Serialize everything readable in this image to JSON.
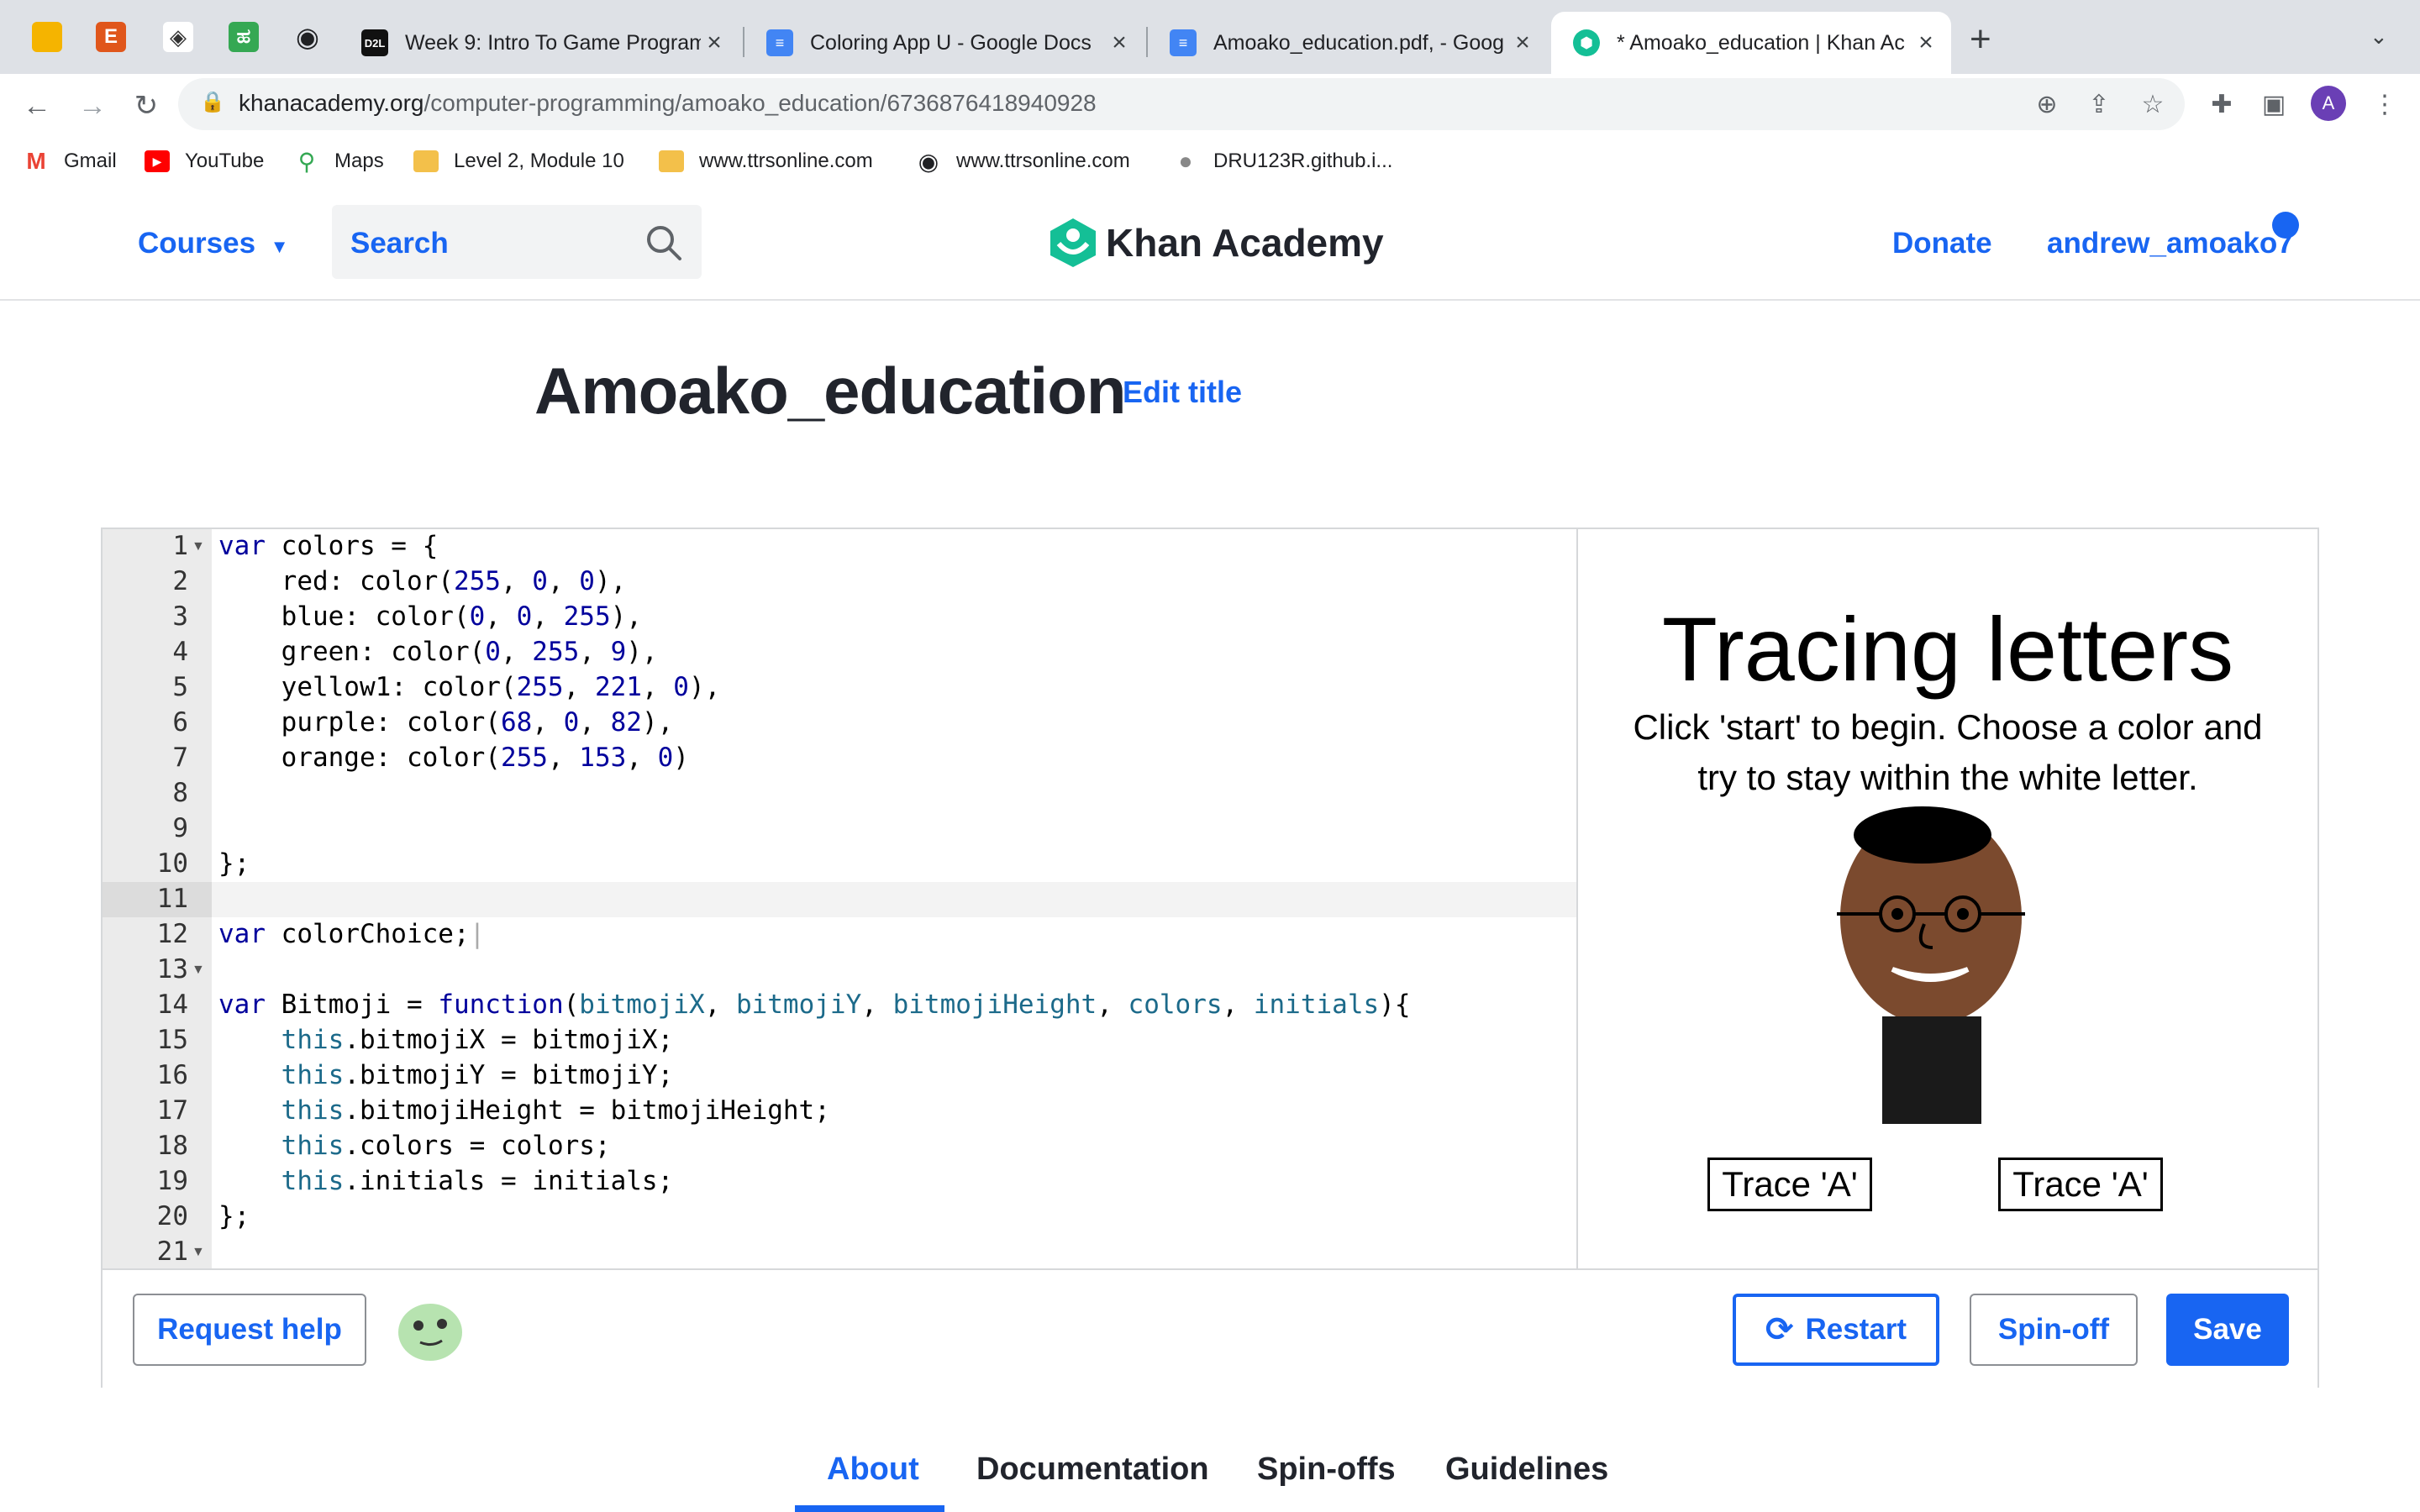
{
  "browser": {
    "pinned_tabs": [
      {
        "icon": "slides-icon",
        "color": "#f5b400"
      },
      {
        "icon": "etsy-e-icon",
        "label": "E",
        "color": "#e0561b"
      },
      {
        "icon": "diamond-icon",
        "color": "#333333"
      },
      {
        "icon": "green-app-icon",
        "color": "#35a853"
      },
      {
        "icon": "globe-icon",
        "color": "#202124"
      }
    ],
    "tabs": [
      {
        "title": "Week 9: Intro To Game Program",
        "favicon": "D2L"
      },
      {
        "title": "Coloring App U - Google Docs",
        "favicon": "docs"
      },
      {
        "title": "Amoako_education.pdf, - Goog",
        "favicon": "docs"
      },
      {
        "title": "* Amoako_education | Khan Ac",
        "favicon": "khan",
        "active": true
      }
    ],
    "new_tab": "+",
    "url_host": "khanacademy.org",
    "url_path": "/computer-programming/amoako_education/6736876418940928",
    "profile_initial": "A",
    "bookmarks": [
      {
        "label": "Gmail",
        "icon": "gmail-icon"
      },
      {
        "label": "YouTube",
        "icon": "youtube-icon"
      },
      {
        "label": "Maps",
        "icon": "maps-icon"
      },
      {
        "label": "Level 2, Module 10",
        "icon": "folder-icon"
      },
      {
        "label": "www.ttrsonline.com",
        "icon": "folder-icon"
      },
      {
        "label": "www.ttrsonline.com",
        "icon": "globe-icon"
      },
      {
        "label": "DRU123R.github.i...",
        "icon": "github-icon"
      }
    ]
  },
  "header": {
    "courses": "Courses",
    "search_placeholder": "Search",
    "logo_text": "Khan Academy",
    "donate": "Donate",
    "username": "andrew_amoako7"
  },
  "project": {
    "title": "Amoako_education",
    "edit_title": "Edit title"
  },
  "editor": {
    "line_numbers": [
      "1",
      "2",
      "3",
      "4",
      "5",
      "6",
      "7",
      "8",
      "9",
      "10",
      "11",
      "12",
      "13",
      "14",
      "15",
      "16",
      "17",
      "18",
      "19",
      "20",
      "21"
    ],
    "active_line": 11
  },
  "canvas": {
    "title": "Tracing letters",
    "instruction_line1": "Click 'start' to begin. Choose a color and",
    "instruction_line2": "try to stay within the white letter.",
    "buttons": [
      "Trace 'A'",
      "Trace 'A'"
    ]
  },
  "actions": {
    "request_help": "Request help",
    "restart": "Restart",
    "spinoff": "Spin-off",
    "save": "Save"
  },
  "bottom_tabs": [
    "About",
    "Documentation",
    "Spin-offs",
    "Guidelines"
  ],
  "colors": {
    "ka_blue": "#1865f2",
    "ka_green": "#14bf96",
    "text_dark": "#21242c"
  }
}
